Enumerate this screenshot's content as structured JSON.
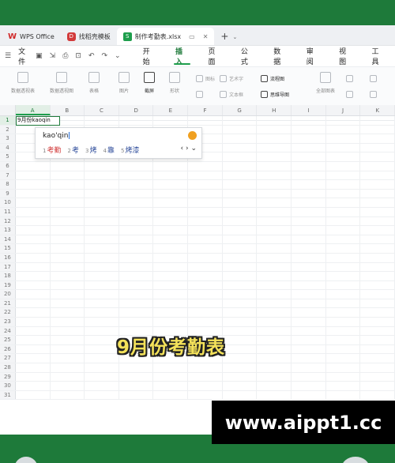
{
  "tabs": [
    {
      "label": "WPS Office",
      "icon": "wps-logo-icon"
    },
    {
      "label": "找稻壳模板",
      "icon": "docer-icon"
    },
    {
      "label": "制作考勤表.xlsx",
      "icon": "spreadsheet-icon"
    }
  ],
  "new_tab_symbol": "+",
  "file_menu": "文件",
  "menus": [
    "开始",
    "插入",
    "页面",
    "公式",
    "数据",
    "审阅",
    "视图",
    "工具"
  ],
  "active_menu": "插入",
  "ribbon": {
    "pivot_table": "数据透视表",
    "pivot_chart": "数据透视图",
    "table": "表格",
    "picture": "图片",
    "screenshot": "截屏",
    "shape": "形状",
    "icon": "图标",
    "art_text": "艺术字",
    "flowchart": "流程图",
    "text_box": "文本框",
    "mind_map": "思维导图",
    "all_charts": "全部图表"
  },
  "columns": [
    "A",
    "B",
    "C",
    "D",
    "E",
    "F",
    "G",
    "H",
    "I",
    "J",
    "K"
  ],
  "rows": [
    "1",
    "2",
    "3",
    "4",
    "5",
    "6",
    "7",
    "8",
    "9",
    "10",
    "11",
    "12",
    "13",
    "14",
    "15",
    "16",
    "17",
    "18",
    "19",
    "20",
    "21",
    "22",
    "23",
    "24",
    "25",
    "26",
    "27",
    "28",
    "29",
    "30",
    "31"
  ],
  "active_cell_text": "9月份kaoqin",
  "ime": {
    "pinyin": "kao'qin",
    "candidates": [
      {
        "num": "1",
        "text": "考勤"
      },
      {
        "num": "2",
        "text": "考"
      },
      {
        "num": "3",
        "text": "烤"
      },
      {
        "num": "4",
        "text": "靠"
      },
      {
        "num": "5",
        "text": "烤漆"
      }
    ],
    "nav": "‹ › ⌄"
  },
  "caption": "9月份考勤表",
  "watermark": "www.aippt1.cc",
  "colors": {
    "accent": "#1e9e4c",
    "background": "#1e7a3a",
    "caption": "#f4e25a"
  }
}
